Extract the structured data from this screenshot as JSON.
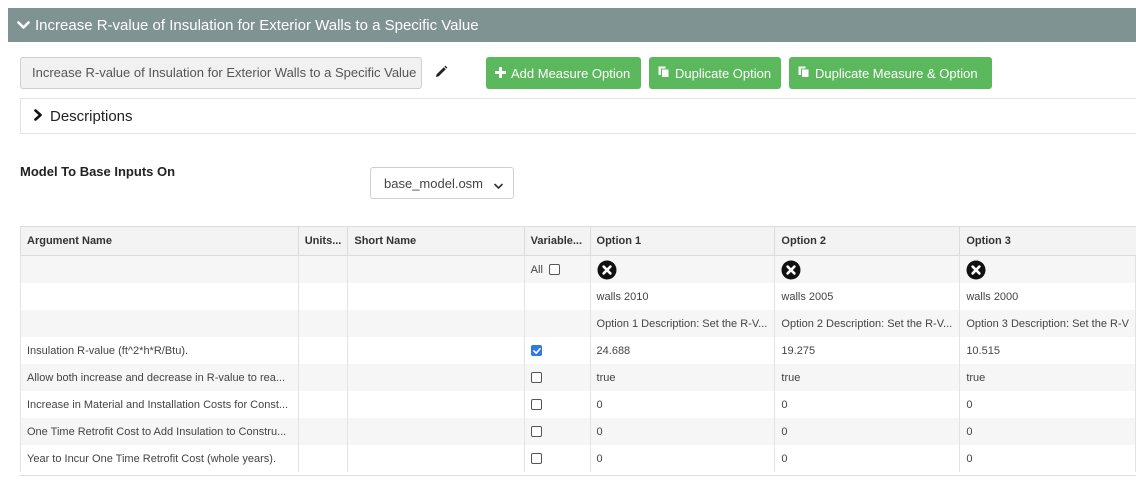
{
  "measure": {
    "header_title": "Increase R-value of Insulation for Exterior Walls to a Specific Value",
    "name_value": "Increase R-value of Insulation for Exterior Walls to a Specific Value",
    "buttons": {
      "add_option": "Add Measure Option",
      "duplicate_option": "Duplicate Option",
      "duplicate_measure": "Duplicate Measure & Option"
    },
    "descriptions_label": "Descriptions"
  },
  "model": {
    "label": "Model To Base Inputs On",
    "selected": "base_model.osm"
  },
  "table": {
    "headers": {
      "argument": "Argument Name",
      "units": "Units...",
      "short_name": "Short Name",
      "variable": "Variable...",
      "opt1": "Option 1",
      "opt2": "Option 2",
      "opt3": "Option 3"
    },
    "all_label": "All",
    "option_names": [
      "walls 2010",
      "walls 2005",
      "walls 2000"
    ],
    "option_descriptions": [
      "Option 1 Description: Set the R-V...",
      "Option 2 Description: Set the R-V...",
      "Option 3 Description: Set the R-V"
    ],
    "rows": [
      {
        "name": "Insulation R-value (ft^2*h*R/Btu).",
        "variable_checked": true,
        "values": [
          "24.688",
          "19.275",
          "10.515"
        ]
      },
      {
        "name": "Allow both increase and decrease in R-value to rea...",
        "variable_checked": false,
        "values": [
          "true",
          "true",
          "true"
        ]
      },
      {
        "name": "Increase in Material and Installation Costs for Const...",
        "variable_checked": false,
        "values": [
          "0",
          "0",
          "0"
        ]
      },
      {
        "name": "One Time Retrofit Cost to Add Insulation to Constru...",
        "variable_checked": false,
        "values": [
          "0",
          "0",
          "0"
        ]
      },
      {
        "name": "Year to Incur One Time Retrofit Cost (whole years).",
        "variable_checked": false,
        "values": [
          "0",
          "0",
          "0"
        ]
      }
    ]
  },
  "colors": {
    "header_bar": "#7f9393",
    "button_green": "#5cb85c",
    "checkbox_checked": "#2f7ae5"
  },
  "icons": {
    "header_toggle": "chevron-down-icon",
    "edit": "pencil-icon",
    "add": "plus-icon",
    "duplicate": "copy-icon",
    "descriptions_toggle": "chevron-right-icon",
    "delete_option": "close-circle-icon",
    "select_caret": "chevron-down-icon"
  }
}
